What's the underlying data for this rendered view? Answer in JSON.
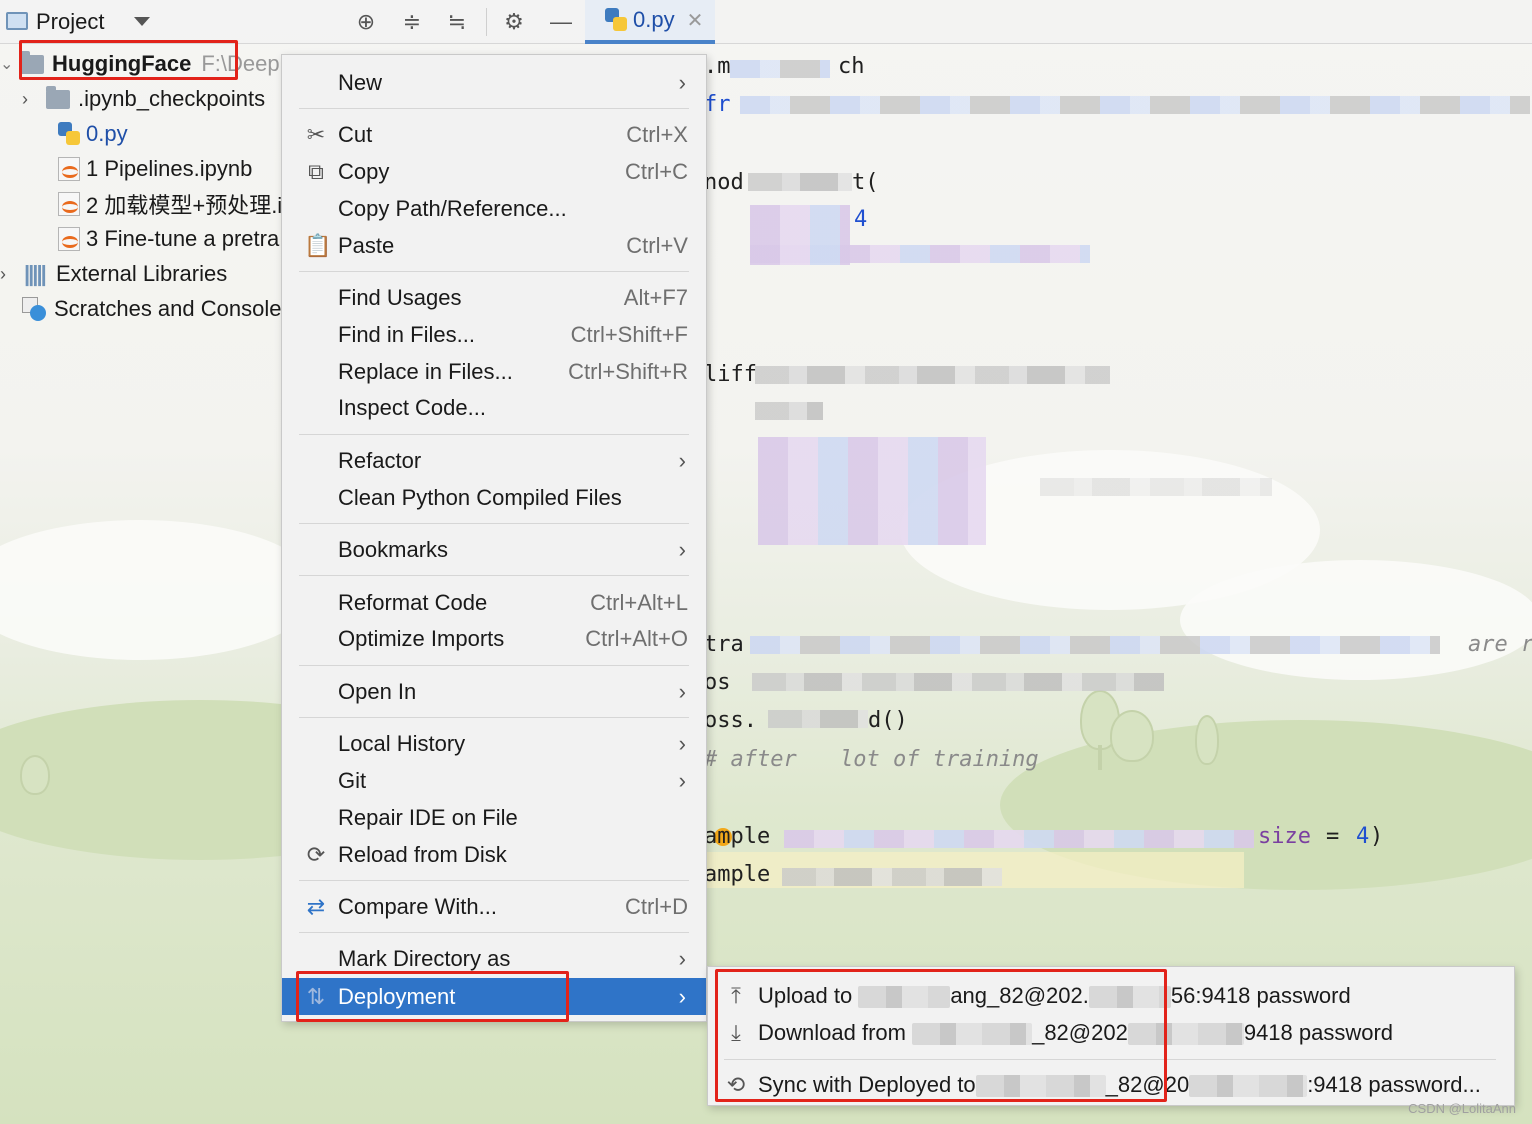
{
  "project_panel": {
    "title": "Project",
    "toolbar_icons": [
      "locate-icon",
      "expand-all-icon",
      "collapse-all-icon",
      "gear-icon",
      "minimize-icon"
    ],
    "tree": [
      {
        "label": "HuggingFace",
        "path_hint": "F:\\Deep",
        "icon": "folder-icon"
      },
      {
        "label": ".ipynb_checkpoints",
        "icon": "folder-icon"
      },
      {
        "label": "0.py",
        "icon": "python-file-icon"
      },
      {
        "label": "1 Pipelines.ipynb",
        "icon": "notebook-icon"
      },
      {
        "label": "2 加载模型+预处理.i",
        "icon": "notebook-icon"
      },
      {
        "label": "3 Fine-tune a pretra",
        "icon": "notebook-icon"
      },
      {
        "label": "External Libraries",
        "icon": "libraries-icon"
      },
      {
        "label": "Scratches and Console",
        "icon": "scratches-icon"
      }
    ]
  },
  "editor": {
    "tab_label": "0.py",
    "code_fragments": {
      "l1": ".m",
      "l1b": "ch",
      "l2": "fr",
      "l3": "nod",
      "l3b": "t(",
      "l4": "4",
      "l5": "liff",
      "l6": "tra",
      "l6b": "are r",
      "l7": "os",
      "l8": "oss.",
      "l8b": "d()",
      "l9": "# after",
      "l9b": "lot of training",
      "l10": "ample",
      "l10b": "size",
      "l10c": "=",
      "l10d": "4",
      "l10e": ")",
      "l11": "ample"
    }
  },
  "context_menu": {
    "items": [
      {
        "label": "New",
        "shortcut": "",
        "submenu": true
      },
      {
        "label": "Cut",
        "shortcut": "Ctrl+X",
        "icon": "cut-icon"
      },
      {
        "label": "Copy",
        "shortcut": "Ctrl+C",
        "icon": "copy-icon"
      },
      {
        "label": "Copy Path/Reference...",
        "shortcut": ""
      },
      {
        "label": "Paste",
        "shortcut": "Ctrl+V",
        "icon": "paste-icon"
      },
      {
        "label": "Find Usages",
        "shortcut": "Alt+F7"
      },
      {
        "label": "Find in Files...",
        "shortcut": "Ctrl+Shift+F"
      },
      {
        "label": "Replace in Files...",
        "shortcut": "Ctrl+Shift+R"
      },
      {
        "label": "Inspect Code...",
        "shortcut": ""
      },
      {
        "label": "Refactor",
        "shortcut": "",
        "submenu": true
      },
      {
        "label": "Clean Python Compiled Files",
        "shortcut": ""
      },
      {
        "label": "Bookmarks",
        "shortcut": "",
        "submenu": true
      },
      {
        "label": "Reformat Code",
        "shortcut": "Ctrl+Alt+L"
      },
      {
        "label": "Optimize Imports",
        "shortcut": "Ctrl+Alt+O"
      },
      {
        "label": "Open In",
        "shortcut": "",
        "submenu": true
      },
      {
        "label": "Local History",
        "shortcut": "",
        "submenu": true
      },
      {
        "label": "Git",
        "shortcut": "",
        "submenu": true
      },
      {
        "label": "Repair IDE on File",
        "shortcut": ""
      },
      {
        "label": "Reload from Disk",
        "shortcut": "",
        "icon": "reload-icon"
      },
      {
        "label": "Compare With...",
        "shortcut": "Ctrl+D",
        "icon": "compare-icon"
      },
      {
        "label": "Mark Directory as",
        "shortcut": "",
        "submenu": true
      },
      {
        "label": "Deployment",
        "shortcut": "",
        "submenu": true,
        "selected": true,
        "icon": "deployment-icon"
      }
    ]
  },
  "deployment_submenu": {
    "items": [
      {
        "prefix": "Upload to",
        "mid": "ang_82@202.",
        "suffix": "56:9418 password",
        "icon": "upload-icon"
      },
      {
        "prefix": "Download from",
        "mid": "_82@202",
        "suffix": "9418 password",
        "icon": "download-icon"
      },
      {
        "prefix": "Sync with Deployed to",
        "mid": "_82@20",
        "suffix": ":9418 password...",
        "icon": "sync-icon"
      }
    ]
  },
  "watermark": "CSDN @LolitaAnn",
  "colors": {
    "selection": "#2f74c8",
    "highlight_box": "#e2231a",
    "tab_accent": "#4a83c9"
  }
}
